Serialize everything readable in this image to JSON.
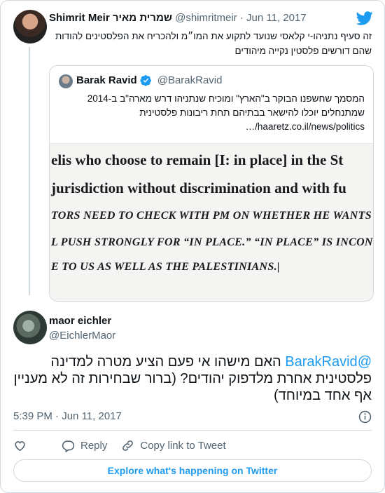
{
  "parent_tweet": {
    "display_name": "Shimrit Meir שמרית מאיר",
    "handle": "@shimritmeir",
    "date": "Jun 11, 2017",
    "text": "זה סעיף נתניהו-י קלאסי שנועד לתקוע את המו״מ ולהכריח את הפלסטינים להודות שהם דורשים פלסטין נקייה מיהודים"
  },
  "quoted_tweet": {
    "display_name": "Barak Ravid",
    "handle": "@BarakRavid",
    "text": "המסמך שחשפנו הבוקר ב\"הארץ\" ומוכיח שנתניהו דרש מארה\"ב ב-2014 שמתנחלים יוכלו להישאר בבתיהם תחת ריבונות פלסטינית",
    "link": "haaretz.co.il/news/politics/…",
    "image_lines": [
      "elis who choose to remain [I:  in place] in the St",
      "jurisdiction without discrimination and with fu",
      "TORS NEED TO CHECK WITH PM ON WHETHER HE WANTS TO",
      "L PUSH STRONGLY FOR “IN PLACE.”  “IN PLACE” IS INCONSIS",
      "E TO US AS WELL AS THE PALESTINIANS.|"
    ]
  },
  "main_tweet": {
    "display_name": "maor eichler",
    "handle": "@EichlerMaor",
    "mention": "@BarakRavid",
    "text": " האם מישהו אי פעם הציע מטרה למדינה פלסטינית אחרת מלדפוק יהודים? (ברור שבחירות זה לא מעניין אף אחד במיוחד)",
    "time": "5:39 PM",
    "date": "Jun 11, 2017"
  },
  "actions": {
    "reply": "Reply",
    "copy_link": "Copy link to Tweet"
  },
  "explore_label": "Explore what's happening on Twitter",
  "colors": {
    "accent": "#1d9bf0",
    "muted": "#536471",
    "border": "#cfd9de"
  },
  "icons": [
    "twitter-bird-icon",
    "verified-badge-icon",
    "info-icon",
    "heart-icon",
    "reply-icon",
    "link-icon"
  ]
}
